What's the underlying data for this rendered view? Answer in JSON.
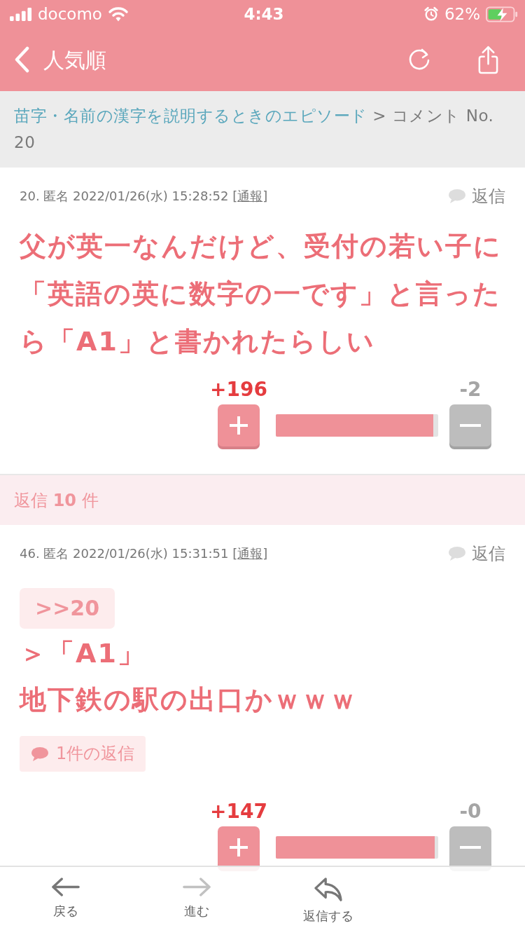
{
  "status_bar": {
    "carrier": "docomo",
    "time": "4:43",
    "battery": "62%"
  },
  "nav_bar": {
    "title": "人気順"
  },
  "breadcrumb": {
    "link": "苗字・名前の漢字を説明するときのエピソード",
    "separator": ">",
    "current": "コメント No. 20"
  },
  "comment": {
    "meta": "20. 匿名 2022/01/26(水) 15:28:52",
    "report": {
      "open": "[",
      "label": "通報",
      "close": "]"
    },
    "reply": "返信",
    "body": [
      "父が英一なんだけど、受付の若い子に「英語の英に数字の一です」と言ったら「A1」と書かれたらしい"
    ],
    "votes": {
      "plus": "+196",
      "minus": "-2",
      "level": 0.97
    }
  },
  "replies_header": "返信 **10** 件",
  "replies": [
    {
      "meta": "46. 匿名 2022/01/26(水) 15:31:51",
      "report": {
        "open": "[",
        "label": "通報",
        "close": "]"
      },
      "reply": "返信",
      "anchor": ">>20",
      "body": [
        "＞「A1」",
        "地下鉄の駅の出口かｗｗｗ"
      ],
      "reply_count": "1件の返信",
      "votes": {
        "plus": "+147",
        "minus": "-0",
        "level": 0.98
      }
    }
  ],
  "toolbar": [
    {
      "kind": "back",
      "label": "戻る",
      "disabled": false
    },
    {
      "kind": "forward",
      "label": "進む",
      "disabled": true
    },
    {
      "kind": "reply",
      "label": "返信する",
      "disabled": false
    }
  ]
}
